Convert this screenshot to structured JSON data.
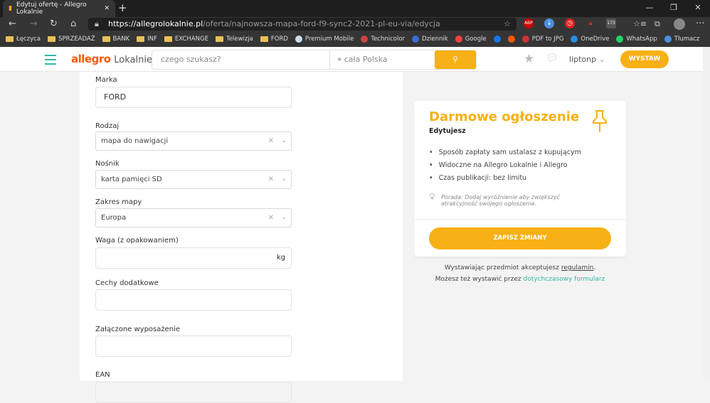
{
  "browser": {
    "tab_title": "Edytuj ofertę - Allegro Lokalnie",
    "url_host": "https://allegrolokalnie.pl",
    "url_path": "/oferta/najnowsza-mapa-ford-f9-sync2-2021-pl-eu-via/edycja",
    "gmail_count": "173",
    "bookmarks": [
      {
        "label": "Łęczyca",
        "icon": "folder"
      },
      {
        "label": "SPRZEADAŻ",
        "icon": "folder"
      },
      {
        "label": "BANK",
        "icon": "folder"
      },
      {
        "label": "INF",
        "icon": "folder"
      },
      {
        "label": "EXCHANGE",
        "icon": "folder"
      },
      {
        "label": "Telewizja",
        "icon": "folder"
      },
      {
        "label": "FORD",
        "icon": "folder"
      },
      {
        "label": "Premium Mobile",
        "icon": "page"
      },
      {
        "label": "Technicolor",
        "icon": "tools"
      },
      {
        "label": "Dziennik",
        "icon": "dziennik"
      },
      {
        "label": "Google",
        "icon": "google"
      },
      {
        "label": "",
        "icon": "facebook"
      },
      {
        "label": "",
        "icon": "allegro"
      },
      {
        "label": "PDF to JPG",
        "icon": "pdf"
      },
      {
        "label": "OneDrive",
        "icon": "onedrive"
      },
      {
        "label": "WhatsApp",
        "icon": "whatsapp"
      },
      {
        "label": "Tłumacz",
        "icon": "translate"
      }
    ]
  },
  "header": {
    "logo": "allegro",
    "logo_sub": "Lokalnie",
    "search_placeholder": "czego szukasz?",
    "location": "cała Polska",
    "user": "liptonp",
    "cta": "WYSTAW"
  },
  "form": {
    "fields": [
      {
        "label": "Marka",
        "value": "FORD",
        "type": "input"
      },
      {
        "label": "Rodzaj",
        "value": "mapa do nawigacji",
        "type": "select"
      },
      {
        "label": "Nośnik",
        "value": "karta pamięci SD",
        "type": "select"
      },
      {
        "label": "Zakres mapy",
        "value": "Europa",
        "type": "select"
      },
      {
        "label": "Waga (z opakowaniem)",
        "value": "",
        "unit": "kg",
        "type": "input"
      },
      {
        "label": "Cechy dodatkowe",
        "value": "",
        "type": "input"
      },
      {
        "label": "Załączone wyposażenie",
        "value": "",
        "type": "input"
      },
      {
        "label": "EAN",
        "type": "input"
      }
    ]
  },
  "card": {
    "title": "Darmowe ogłoszenie",
    "subtitle": "Edytujesz",
    "features": [
      "Sposób zapłaty sam ustalasz z kupującym",
      "Widoczne na Allegro Lokalnie i Allegro",
      "Czas publikacji: bez limitu"
    ],
    "tip_line1": "Porada: Dodaj wyróżnienie aby zwiększyć",
    "tip_line2": "atrakcyjność swojego ogłoszenia.",
    "save": "ZAPISZ ZMIANY"
  },
  "notes": {
    "accept_prefix": "Wystawiając przedmiot akceptujesz ",
    "accept_link": "regulamin",
    "accept_suffix": ".",
    "alt_prefix": "Możesz też wystawić przez ",
    "alt_link": "dotychczasowy formularz"
  },
  "colors": {
    "accent": "#f7b015",
    "brand": "#ff5a00",
    "teal": "#2fb9a8"
  }
}
